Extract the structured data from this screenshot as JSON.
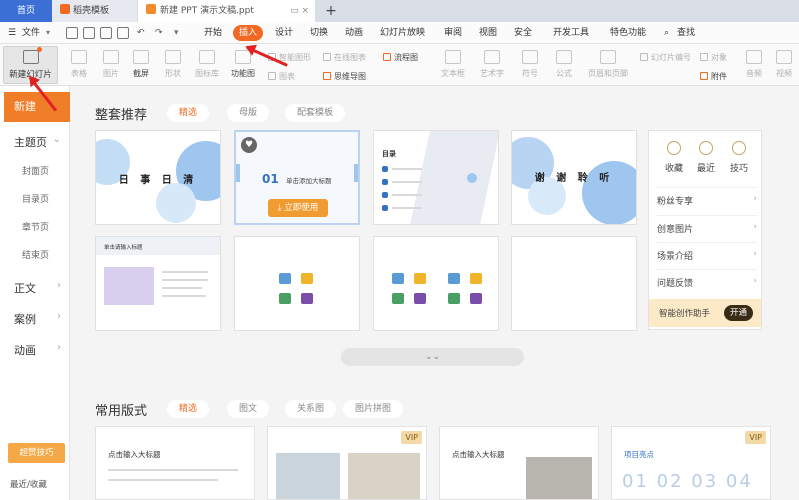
{
  "tabs": {
    "home": "首页",
    "templates": "稻壳模板",
    "document": "新建 PPT 演示文稿.ppt"
  },
  "menubar": {
    "file": "文件",
    "items": [
      "开始",
      "插入",
      "设计",
      "切换",
      "动画",
      "幻灯片放映",
      "审阅",
      "视图",
      "安全",
      "开发工具",
      "特色功能"
    ],
    "active": "插入",
    "search": "查找"
  },
  "ribbon": {
    "new_slide": "新建幻灯片",
    "table": "表格",
    "picture": "图片",
    "screenshot": "截屏",
    "shape": "形状",
    "icon_library": "图标库",
    "function_chart": "功能图",
    "smart_graphic": "智能图形",
    "chart": "图表",
    "online_chart": "在线图表",
    "flowchart": "流程图",
    "mind_map": "思维导图",
    "textbox": "文本框",
    "art_text": "艺术字",
    "symbol": "符号",
    "formula": "公式",
    "header_footer": "页眉和页脚",
    "slide_number": "幻灯片编号",
    "object": "对象",
    "attachment": "附件",
    "audio": "音频",
    "video": "视频"
  },
  "sidebar": {
    "new": "新建",
    "theme_page": "主题页",
    "sub_items": [
      "封面页",
      "目录页",
      "章节页",
      "结束页"
    ],
    "body": "正文",
    "cases": "案例",
    "animation": "动画",
    "tips": "超赞技巧",
    "recent": "最近/收藏"
  },
  "main": {
    "section1_title": "整套推荐",
    "section1_pills": [
      "精选",
      "母版",
      "配套模板"
    ],
    "card1_title": "日 事 日 清",
    "card2_number": "01",
    "card2_subtitle": "单击添加大标题",
    "use_now": "立即使用",
    "card3_heading": "目录",
    "card4_title": "谢 谢 聆 听",
    "card5_heading": "单击请输入标题",
    "section2_title": "常用版式",
    "section2_pills": [
      "精选",
      "图文",
      "关系图",
      "图片拼图"
    ],
    "bcard1_text": "点击输入大标题",
    "bcard3_text": "点击输入大标题",
    "bcard4_text": "项目亮点",
    "bcard4_numbers": "01 02 03 04",
    "vip": "VIP"
  },
  "right_panel": {
    "favorite": "收藏",
    "recent": "最近",
    "tips": "技巧",
    "rows": [
      "粉丝专享",
      "创意图片",
      "场景介绍",
      "问题反馈"
    ],
    "ai_label": "智能创作助手",
    "ai_button": "开通"
  },
  "colors": {
    "accent": "#f06a23",
    "active_tab": "#3b6fd6",
    "annotation": "#e02222"
  }
}
